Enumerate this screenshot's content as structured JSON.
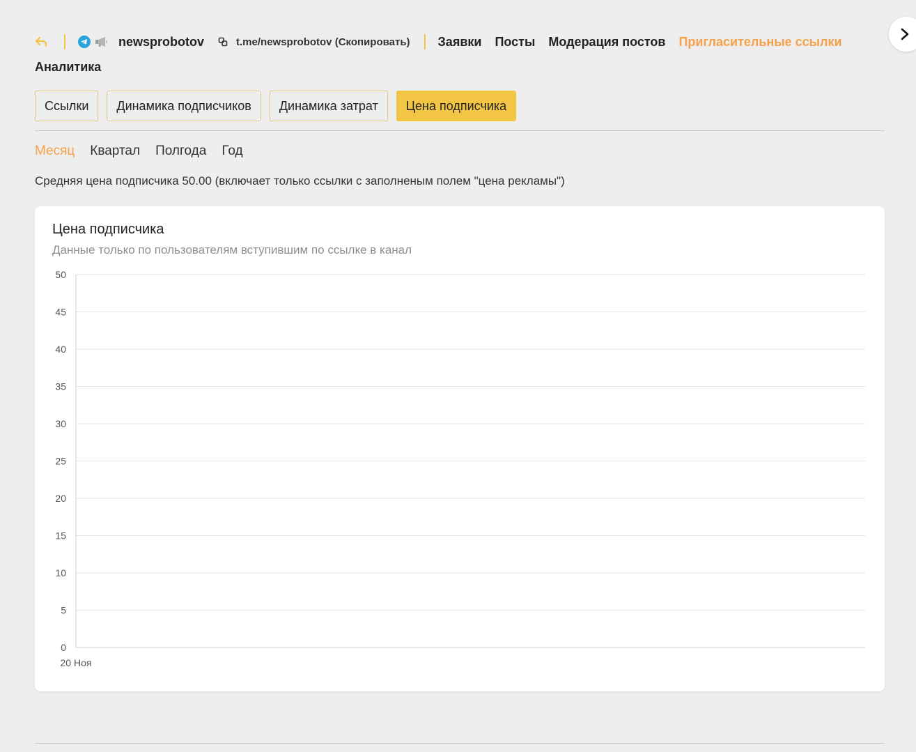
{
  "header": {
    "channel_name": "newsprobotov",
    "channel_link": "t.me/newsprobotov (Скопировать)",
    "nav": [
      {
        "label": "Заявки",
        "active": false
      },
      {
        "label": "Посты",
        "active": false
      },
      {
        "label": "Модерация постов",
        "active": false
      },
      {
        "label": "Пригласительные ссылки",
        "active": true
      },
      {
        "label": "Аналитика",
        "active": false
      }
    ]
  },
  "tabs": [
    {
      "label": "Ссылки",
      "active": false
    },
    {
      "label": "Динамика подписчиков",
      "active": false
    },
    {
      "label": "Динамика затрат",
      "active": false
    },
    {
      "label": "Цена подписчика",
      "active": true
    }
  ],
  "periods": [
    {
      "label": "Месяц",
      "active": true
    },
    {
      "label": "Квартал",
      "active": false
    },
    {
      "label": "Полгода",
      "active": false
    },
    {
      "label": "Год",
      "active": false
    }
  ],
  "average_text": "Средняя цена подписчика 50.00 (включает только ссылки с заполненым полем \"цена рекламы\")",
  "colors": {
    "accent": "#f5a04a",
    "tab_active": "#f3c544",
    "telegram": "#2aa3df"
  },
  "icons": {
    "back": "back-arrow-icon",
    "telegram": "telegram-icon",
    "megaphone": "megaphone-icon",
    "copy": "link-icon",
    "next": "chevron-right-icon"
  },
  "chart_data": {
    "type": "line",
    "title": "Цена подписчика",
    "subtitle": "Данные только по пользователям вступившим по ссылке в канал",
    "x": [
      "20 Ноя"
    ],
    "ylim": [
      0,
      50
    ],
    "yticks": [
      0,
      5,
      10,
      15,
      20,
      25,
      30,
      35,
      40,
      45,
      50
    ],
    "series": [],
    "grid": true
  }
}
